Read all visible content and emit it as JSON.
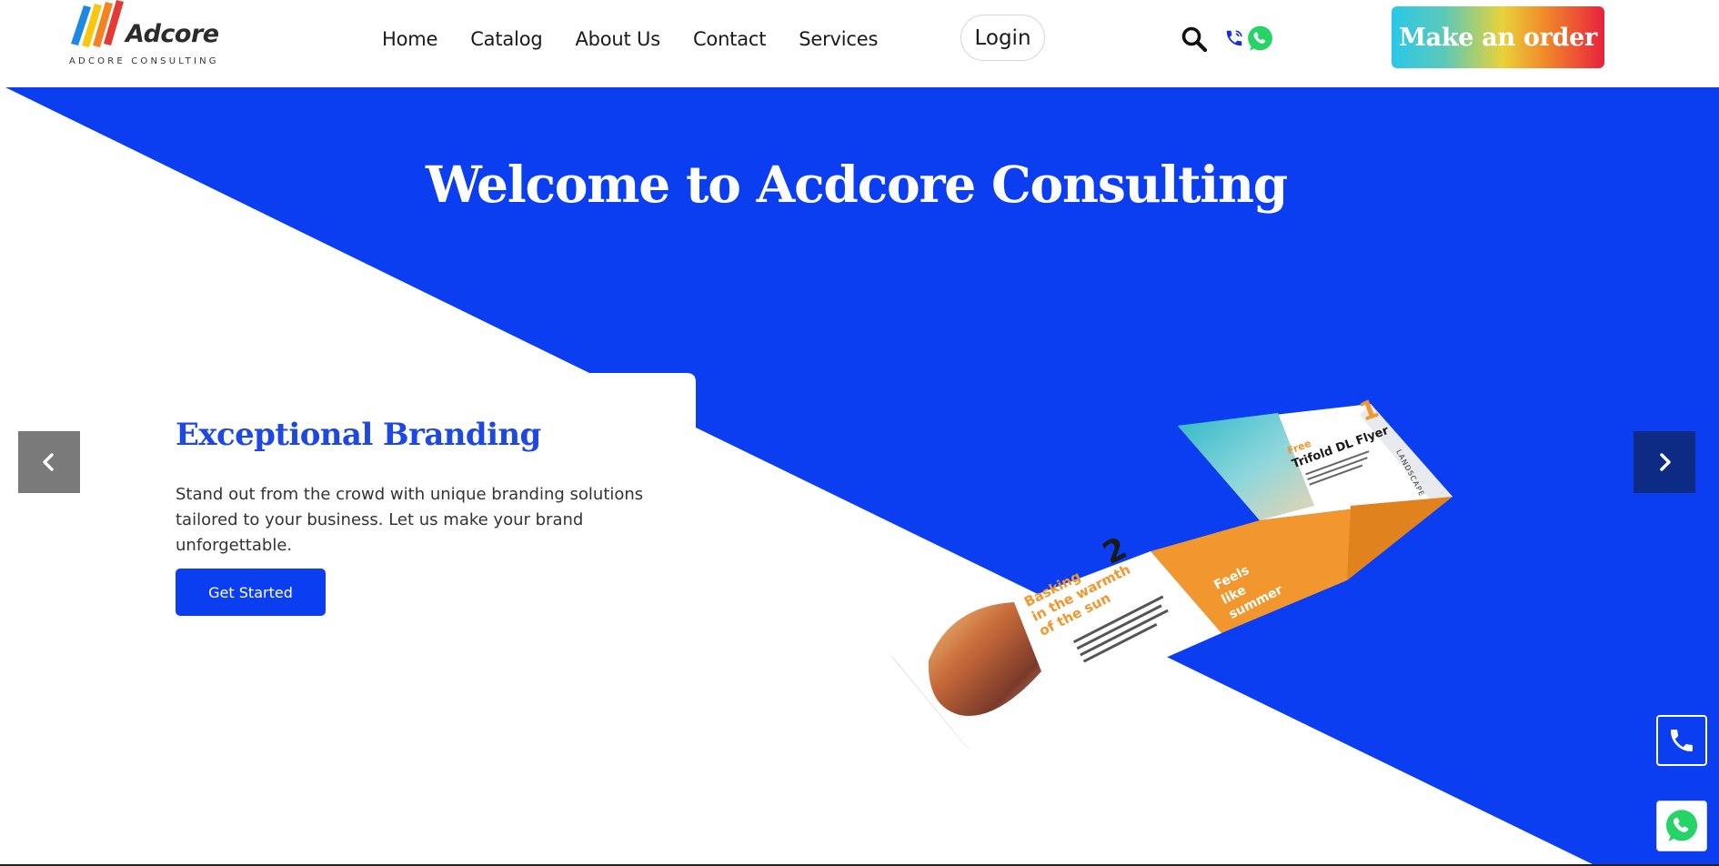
{
  "brand": {
    "name": "Adcore",
    "subtitle": "ADCORE CONSULTING"
  },
  "nav": {
    "items": [
      {
        "label": "Home"
      },
      {
        "label": "Catalog"
      },
      {
        "label": "About Us"
      },
      {
        "label": "Contact"
      },
      {
        "label": "Services"
      }
    ],
    "login_label": "Login"
  },
  "header_icons": [
    "search-icon",
    "phone-icon",
    "whatsapp-icon"
  ],
  "order_button": {
    "label": "Make an order"
  },
  "hero": {
    "title": "Welcome to Acdcore Consulting",
    "slide": {
      "heading": "Exceptional Branding",
      "text": "Stand out from the crowd with unique branding solutions tailored to your business. Let us make your brand unforgettable.",
      "cta_label": "Get Started"
    },
    "flyer": {
      "panel1_tag": "Free",
      "panel1_title": "Trifold DL Flyer",
      "panel1_number": "1",
      "panel1_side_text": "LANDSCAPE",
      "panel2_heading_line1": "Basking",
      "panel2_heading_line2": "in the warmth",
      "panel2_heading_line3": "of the sun",
      "panel2_number": "2",
      "panel3_text_line1": "Feels",
      "panel3_text_line2": "like",
      "panel3_text_line3": "summer"
    }
  },
  "colors": {
    "hero_blue": "#0a3ef0",
    "heading_blue": "#1e49e0",
    "arrow_prev_gray": "#7a7a7a",
    "arrow_next_navy": "#0d2a85",
    "flyer_orange": "#f2962e",
    "whatsapp_green": "#25d366"
  },
  "floating_buttons": [
    "phone-icon",
    "whatsapp-icon"
  ]
}
